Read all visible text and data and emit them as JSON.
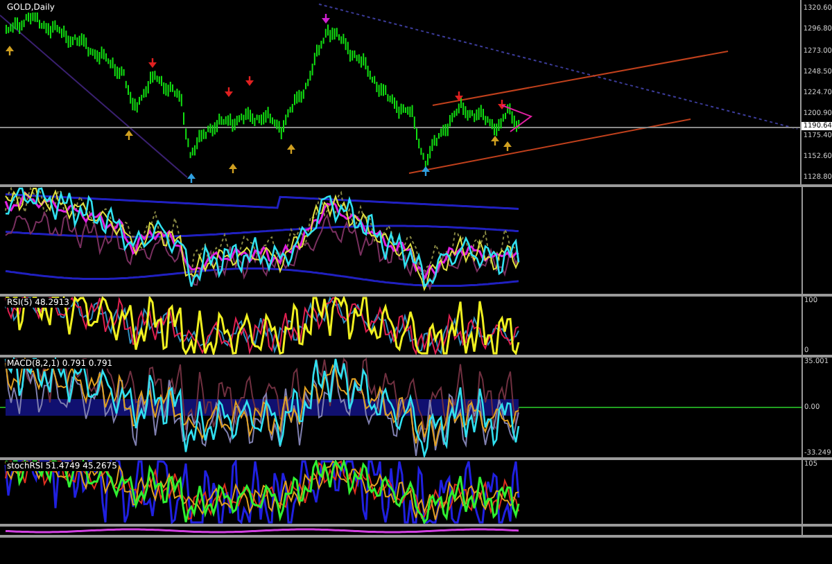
{
  "chart_title": "GOLD,Daily",
  "price_axis": {
    "ticks": [
      "1320.60",
      "1296.80",
      "1273.00",
      "1248.50",
      "1224.70",
      "1200.90",
      "1175.40",
      "1152.60",
      "1128.80"
    ],
    "current_price": "1190.64"
  },
  "panels": [
    {
      "kind": "bands"
    },
    {
      "kind": "rsi",
      "label": "RSI(5) 48.2913",
      "axis_labels": [
        "100",
        "0"
      ]
    },
    {
      "kind": "macd",
      "label": "MACD(8,2,1) 0.791 0.791",
      "axis_labels": [
        "35.001",
        "0.00",
        "-33.249"
      ]
    },
    {
      "kind": "stoch",
      "label": "stochRSI 51.4749 45.2675",
      "axis_labels": [
        "105"
      ]
    },
    {
      "kind": "strip"
    }
  ]
}
